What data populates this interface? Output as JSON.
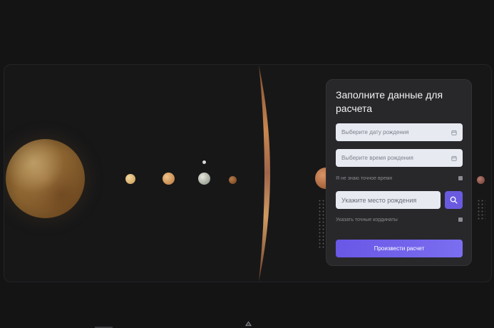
{
  "form": {
    "title": "Заполните данные для расчета",
    "date_placeholder": "Выберите дату рождения",
    "time_placeholder": "Выберите время рождения",
    "unknown_time_label": "Я не знаю точное время",
    "place_placeholder": "Укажите место рождения",
    "exact_coords_label": "Указать точные кординаты",
    "submit_label": "Произвести расчет"
  },
  "icons": {
    "date": "calendar-icon",
    "time": "calendar-icon",
    "search": "search-icon",
    "bottom": "triangle-logo-icon"
  },
  "colors": {
    "accent": "#6a5ae0",
    "background": "#141415",
    "panel": "#28282b",
    "field": "#e8eaf2"
  }
}
